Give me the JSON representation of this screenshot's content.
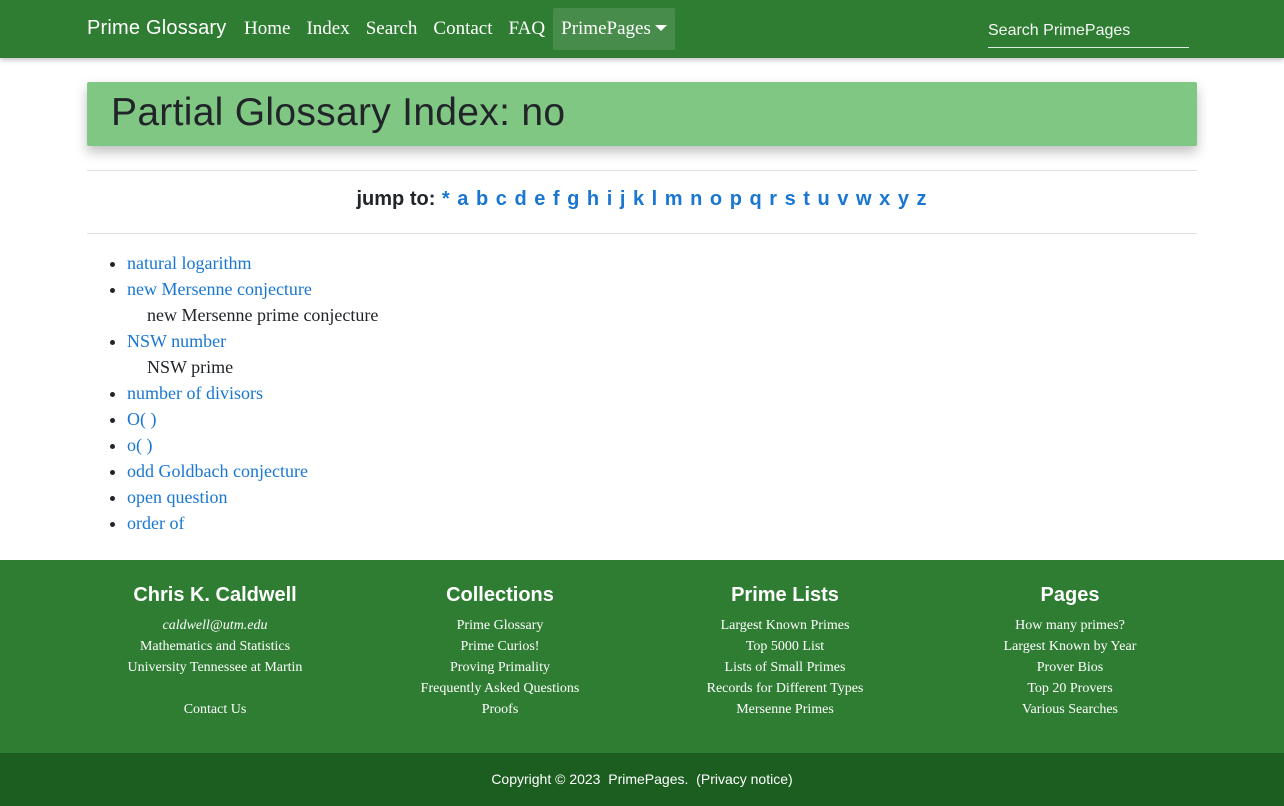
{
  "navbar": {
    "brand": "Prime Glossary",
    "links": [
      "Home",
      "Index",
      "Search",
      "Contact",
      "FAQ"
    ],
    "dropdown_label": "PrimePages",
    "search_placeholder": "Search PrimePages"
  },
  "title": "Partial Glossary Index: no",
  "jump": {
    "label": "jump to:",
    "letters": [
      "*",
      "a",
      "b",
      "c",
      "d",
      "e",
      "f",
      "g",
      "h",
      "i",
      "j",
      "k",
      "l",
      "m",
      "n",
      "o",
      "p",
      "q",
      "r",
      "s",
      "t",
      "u",
      "v",
      "w",
      "x",
      "y",
      "z"
    ]
  },
  "entries": [
    {
      "term": "natural logarithm"
    },
    {
      "term": "new Mersenne conjecture",
      "alias": "new Mersenne prime conjecture"
    },
    {
      "term": "NSW number",
      "alias": "NSW prime"
    },
    {
      "term": "number of divisors"
    },
    {
      "term": "O( )"
    },
    {
      "term": "o( )"
    },
    {
      "term": "odd Goldbach conjecture"
    },
    {
      "term": "open question"
    },
    {
      "term": "order of"
    }
  ],
  "footer": {
    "author": {
      "heading": "Chris K. Caldwell",
      "email": "caldwell@utm.edu",
      "dept": "Mathematics and Statistics",
      "univ": "University Tennessee at Martin",
      "contact": "Contact Us"
    },
    "collections": {
      "heading": "Collections",
      "items": [
        "Prime Glossary",
        "Prime Curios!",
        "Proving Primality",
        "Frequently Asked Questions",
        "Proofs"
      ]
    },
    "prime_lists": {
      "heading": "Prime Lists",
      "items": [
        "Largest Known Primes",
        "Top 5000 List",
        "Lists of Small Primes",
        "Records for Different Types",
        "Mersenne Primes"
      ]
    },
    "pages": {
      "heading": "Pages",
      "items": [
        "How many primes?",
        "Largest Known by Year",
        "Prover Bios",
        "Top 20 Provers",
        "Various Searches"
      ]
    }
  },
  "copyright": {
    "text": "Copyright © 2023",
    "site": "PrimePages",
    "privacy": "Privacy notice"
  }
}
